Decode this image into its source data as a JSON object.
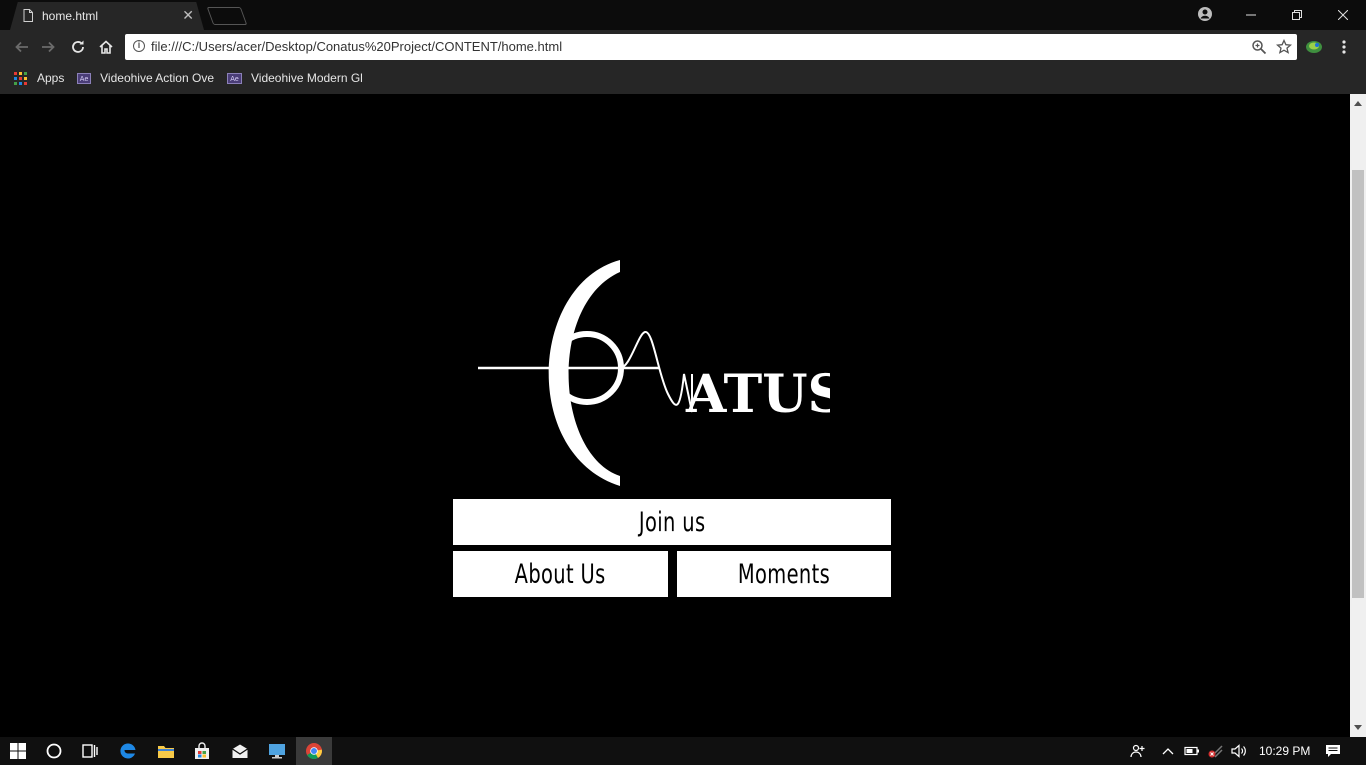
{
  "browser": {
    "tab": {
      "title": "home.html"
    },
    "toolbar": {
      "url": "file:///C:/Users/acer/Desktop/Conatus%20Project/CONTENT/home.html"
    },
    "bookmarks": [
      {
        "label": "Apps",
        "icon": "apps-grid-icon"
      },
      {
        "label": "Videohive Action Ove",
        "icon": "after-effects-icon"
      },
      {
        "label": "Videohive Modern Gl",
        "icon": "after-effects-icon"
      }
    ]
  },
  "page": {
    "logo_text": "ATUS",
    "buttons": {
      "join": "Join us",
      "about": "About Us",
      "moments": "Moments"
    }
  },
  "taskbar": {
    "clock": "10:29 PM"
  },
  "colors": {
    "page_background": "#000000",
    "button_background": "#ffffff",
    "chrome_frame": "#262626"
  }
}
